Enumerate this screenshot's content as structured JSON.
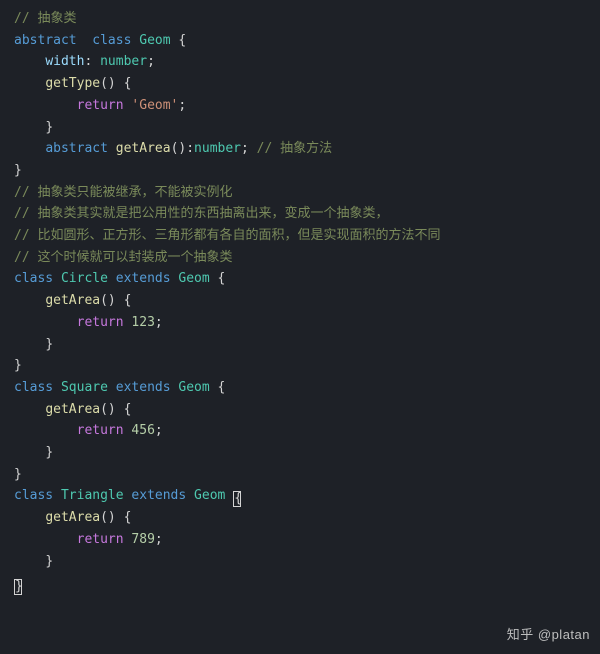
{
  "code": {
    "c_abstract_class": "抽象类",
    "kw_abstract": "abstract",
    "kw_class": "class",
    "cls_geom": "Geom",
    "prop_width": "width",
    "type_number": "number",
    "fn_getType": "getType",
    "kw_return": "return",
    "str_geom": "'Geom'",
    "fn_getArea": "getArea",
    "c_abs_method": "抽象方法",
    "c_line1": "抽象类只能被继承，不能被实例化",
    "c_line2": "抽象类其实就是把公用性的东西抽离出来，变成一个抽象类，",
    "c_line3": "比如圆形、正方形、三角形都有各自的面积，但是实现面积的方法不同",
    "c_line4": "这个时候就可以封装成一个抽象类",
    "cls_circle": "Circle",
    "cls_square": "Square",
    "cls_triangle": "Triangle",
    "kw_extends": "extends",
    "num_123": "123",
    "num_456": "456",
    "num_789": "789"
  },
  "watermark": "知乎 @platan"
}
